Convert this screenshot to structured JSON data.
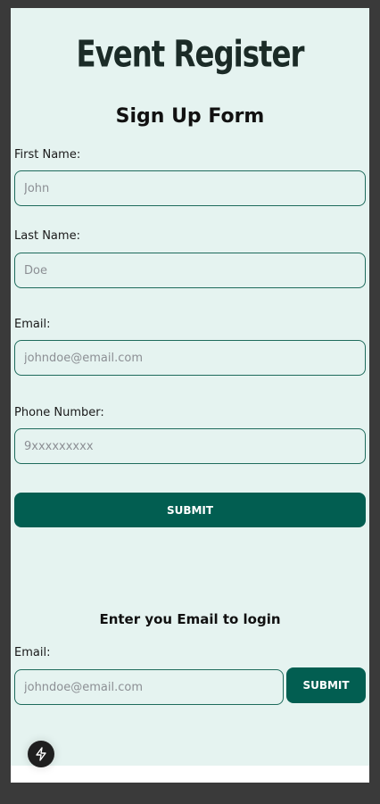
{
  "app": {
    "brand": "Event Register"
  },
  "signup": {
    "title": "Sign Up Form",
    "fields": [
      {
        "label": "First Name:",
        "placeholder": "John",
        "value": ""
      },
      {
        "label": "Last Name:",
        "placeholder": "Doe",
        "value": ""
      },
      {
        "label": "Email:",
        "placeholder": "johndoe@email.com",
        "value": ""
      },
      {
        "label": "Phone Number:",
        "placeholder": "9xxxxxxxxx",
        "value": ""
      }
    ],
    "submit_label": "SUBMIT"
  },
  "login": {
    "title": "Enter you Email to login",
    "email_label": "Email:",
    "email_placeholder": "johndoe@email.com",
    "email_value": "",
    "submit_label": "SUBMIT"
  },
  "fab": {
    "icon": "lightning-bolt-icon"
  },
  "colors": {
    "accent": "#025e51",
    "form_background": "#e5f3f0",
    "input_border": "#1e6b5c",
    "backdrop": "#3a3a3a"
  }
}
